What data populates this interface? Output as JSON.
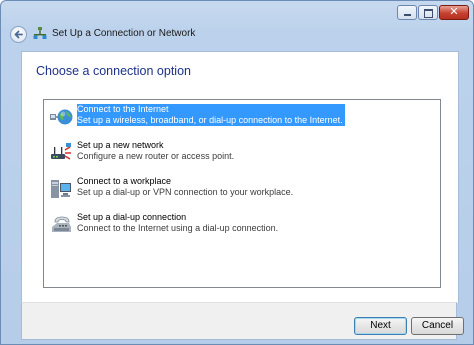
{
  "window": {
    "title": "Set Up a Connection or Network",
    "controls": {
      "minimize": "minimize-icon",
      "maximize": "maximize-icon",
      "close": "✕"
    }
  },
  "page": {
    "heading": "Choose a connection option"
  },
  "options": [
    {
      "title": "Connect to the Internet",
      "description": "Set up a wireless, broadband, or dial-up connection to the Internet.",
      "icon": "globe-network-icon",
      "selected": true
    },
    {
      "title": "Set up a new network",
      "description": "Configure a new router or access point.",
      "icon": "router-icon",
      "selected": false
    },
    {
      "title": "Connect to a workplace",
      "description": "Set up a dial-up or VPN connection to your workplace.",
      "icon": "workplace-computer-icon",
      "selected": false
    },
    {
      "title": "Set up a dial-up connection",
      "description": "Connect to the Internet using a dial-up connection.",
      "icon": "phone-modem-icon",
      "selected": false
    }
  ],
  "buttons": {
    "next": "Next",
    "cancel": "Cancel"
  },
  "colors": {
    "selection": "#3399ff",
    "heading": "#1e3287",
    "frame": "#bcd2ec"
  }
}
